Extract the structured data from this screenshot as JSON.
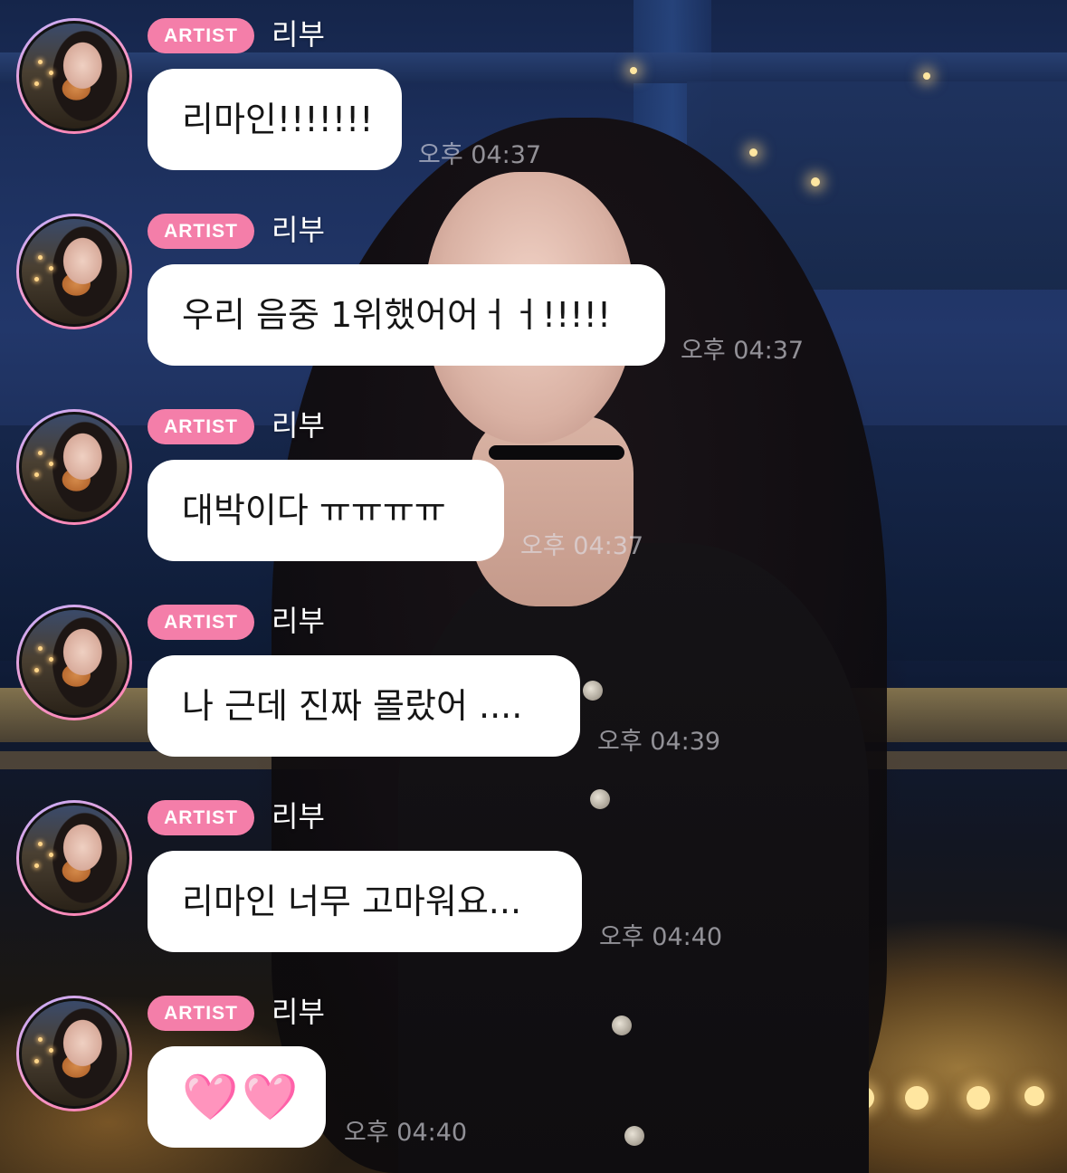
{
  "messages": [
    {
      "badge": "ARTIST",
      "name": "리부",
      "text": "리마인!!!!!!!",
      "time": "오후 04:37"
    },
    {
      "badge": "ARTIST",
      "name": "리부",
      "text": "우리 음중 1위했어어ㅓㅓ!!!!!",
      "time": "오후 04:37"
    },
    {
      "badge": "ARTIST",
      "name": "리부",
      "text": "대박이다 ㅠㅠㅠㅠ",
      "time": "오후 04:37"
    },
    {
      "badge": "ARTIST",
      "name": "리부",
      "text": "나 근데 진짜 몰랐어 ....",
      "time": "오후 04:39"
    },
    {
      "badge": "ARTIST",
      "name": "리부",
      "text": "리마인 너무 고마워요...",
      "time": "오후 04:40"
    },
    {
      "badge": "ARTIST",
      "name": "리부",
      "text": "🩷🩷",
      "time": "오후 04:40"
    }
  ],
  "colors": {
    "badge": "#f47ea9",
    "bubble": "#ffffff",
    "avatar_ring": "#f29acb",
    "heart": "#ff3fbf"
  },
  "icons": {
    "avatar": "artist-profile-photo",
    "heart": "pink-heart-emoji"
  }
}
